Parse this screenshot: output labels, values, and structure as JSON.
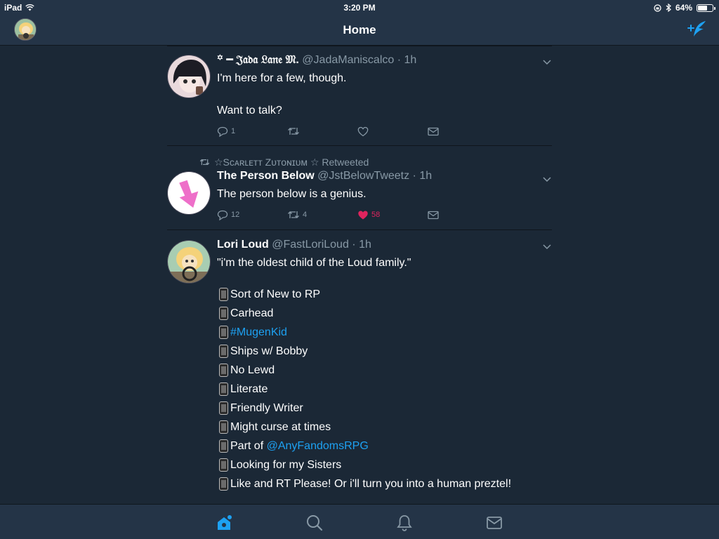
{
  "status_bar": {
    "device": "iPad",
    "time": "3:20 PM",
    "battery": "64%",
    "battery_level": 0.64
  },
  "nav": {
    "title": "Home"
  },
  "tweets": [
    {
      "name": "꙳ ━ 𝔍𝔞𝔡𝔞 𝔏𝔞𝔫𝔢 𝔐.",
      "handle": "@JadaManiscalco",
      "time": "1h",
      "body_lines": [
        "I'm here for a few, though.",
        "Want to talk?"
      ],
      "replies": "1",
      "retweets": "",
      "likes": ""
    },
    {
      "retweeted_by": "☆Sᴄᴀʀʟᴇᴛᴛ Zᴜᴛᴏɴɪᴜᴍ ☆ Retweeted",
      "name": "The Person Below",
      "handle": "@JstBelowTweetz",
      "time": "1h",
      "body_lines": [
        "The person below is a genius."
      ],
      "replies": "12",
      "retweets": "4",
      "likes": "58"
    },
    {
      "name": "Lori Loud",
      "handle": "@FastLoriLoud",
      "time": "1h",
      "body_lines": [
        "\"i'm the oldest child of the Loud family.\""
      ],
      "list": [
        {
          "text": "Sort of New to RP"
        },
        {
          "text": "Carhead"
        },
        {
          "link": "#MugenKid"
        },
        {
          "text": "Ships w/ Bobby"
        },
        {
          "text": "No Lewd"
        },
        {
          "text": "Literate"
        },
        {
          "text": "Friendly Writer"
        },
        {
          "text": "Might curse at times"
        },
        {
          "text": "Part of ",
          "link": "@AnyFandomsRPG"
        },
        {
          "text": "Looking for my Sisters"
        },
        {
          "text": "Like and RT Please! Or i'll turn you into a human preztel!"
        }
      ]
    }
  ],
  "colors": {
    "accent": "#1da1f2",
    "like": "#e0245e",
    "muted": "#8899a6",
    "background": "#1b2836",
    "bar": "#243447"
  }
}
